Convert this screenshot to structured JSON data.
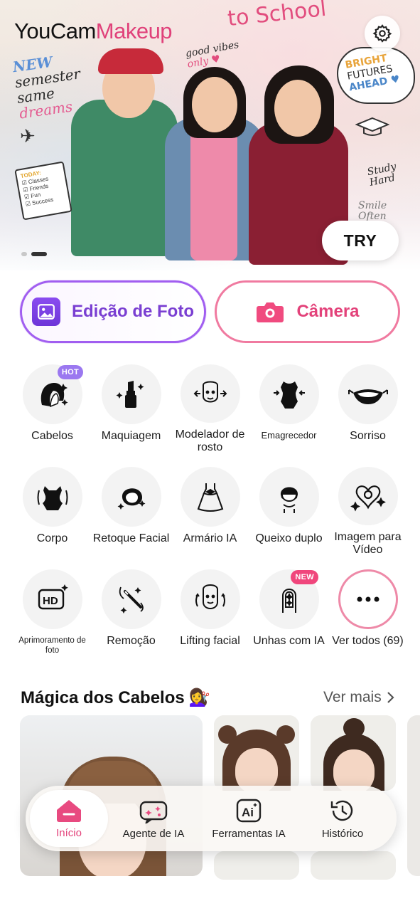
{
  "banner": {
    "logo_part1": "YouCam",
    "logo_part2": "Makeup",
    "doodles": {
      "to_school": "to School",
      "new_word": "NEW",
      "semester": "semester",
      "same": "same",
      "dreams": "dreams",
      "good_vibes": "good vibes",
      "only": "only ♥",
      "bright": "BRIGHT",
      "futures": "FUTURES",
      "ahead": "AHEAD ♥",
      "study_hard": "Study Hard",
      "smile_often": "Smile Often",
      "todo_title": "TODAY:",
      "todo_items": [
        "Classes",
        "Friends",
        "Fun",
        "Success"
      ]
    },
    "try_label": "TRY",
    "carousel_pages": 2,
    "carousel_active": 2
  },
  "actions": {
    "photo_edit_label": "Edição de Foto",
    "camera_label": "Câmera"
  },
  "features": [
    {
      "label": "Cabelos",
      "icon": "hair-icon",
      "badge": "HOT"
    },
    {
      "label": "Maquiagem",
      "icon": "lipstick-icon",
      "badge": ""
    },
    {
      "label": "Modelador de rosto",
      "icon": "face-reshape-icon",
      "badge": ""
    },
    {
      "label": "Emagrecedor",
      "icon": "slim-body-icon",
      "badge": ""
    },
    {
      "label": "Sorriso",
      "icon": "smile-icon",
      "badge": ""
    },
    {
      "label": "Corpo",
      "icon": "body-icon",
      "badge": ""
    },
    {
      "label": "Retoque Facial",
      "icon": "face-retouch-icon",
      "badge": ""
    },
    {
      "label": "Armário IA",
      "icon": "dress-icon",
      "badge": ""
    },
    {
      "label": "Queixo duplo",
      "icon": "double-chin-icon",
      "badge": ""
    },
    {
      "label": "Imagem para Vídeo",
      "icon": "image-to-video-icon",
      "badge": ""
    },
    {
      "label": "Aprimoramento de foto",
      "icon": "hd-enhance-icon",
      "badge": ""
    },
    {
      "label": "Remoção",
      "icon": "remove-wand-icon",
      "badge": ""
    },
    {
      "label": "Lifting facial",
      "icon": "face-lift-icon",
      "badge": ""
    },
    {
      "label": "Unhas com IA",
      "icon": "nail-icon",
      "badge": "NEW"
    },
    {
      "label": "Ver todos (69)",
      "icon": "more-icon",
      "badge": ""
    }
  ],
  "hair_section": {
    "title": "Mágica dos Cabelos",
    "emoji": "💇‍♀️",
    "see_more": "Ver mais"
  },
  "nav": [
    {
      "label": "Início",
      "icon": "home-icon",
      "active": true
    },
    {
      "label": "Agente de IA",
      "icon": "ai-agent-icon",
      "active": false
    },
    {
      "label": "Ferramentas IA",
      "icon": "ai-tools-icon",
      "active": false
    },
    {
      "label": "Histórico",
      "icon": "history-icon",
      "active": false
    }
  ],
  "colors": {
    "brand_pink": "#e3427a",
    "brand_purple": "#7a3fd2",
    "hot_badge": "#9b78f0",
    "new_badge": "#f0467c"
  }
}
